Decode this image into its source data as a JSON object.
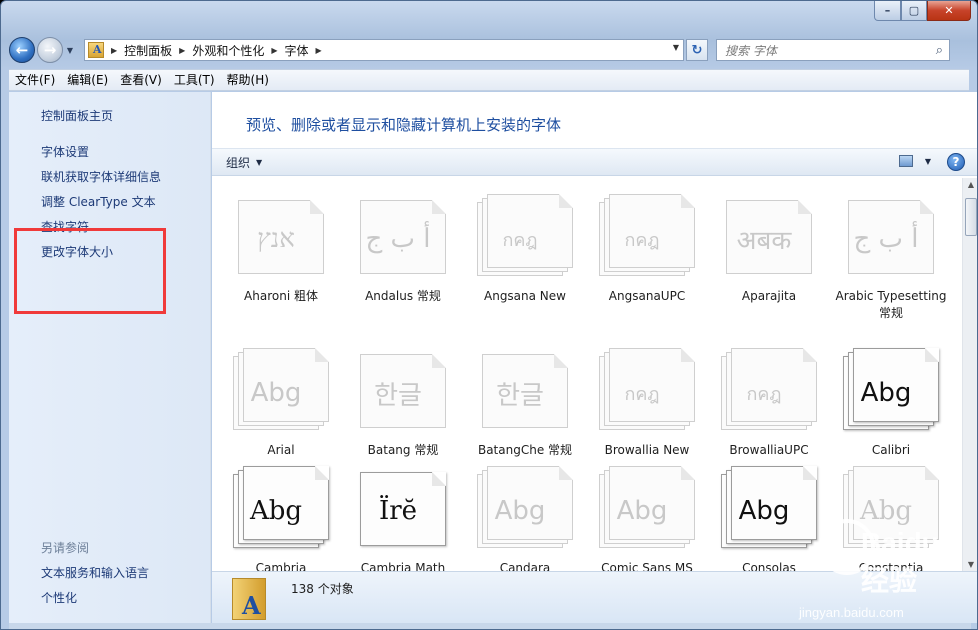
{
  "address": {
    "crumbs": [
      "控制面板",
      "外观和个性化",
      "字体"
    ]
  },
  "search": {
    "placeholder": "搜索 字体"
  },
  "menu": [
    "文件(F)",
    "编辑(E)",
    "查看(V)",
    "工具(T)",
    "帮助(H)"
  ],
  "sidebar": {
    "home": "控制面板主页",
    "links": [
      "字体设置",
      "联机获取字体详细信息",
      "调整 ClearType 文本",
      "查找字符",
      "更改字体大小"
    ],
    "see_also_label": "另请参阅",
    "see_also": [
      "文本服务和输入语言",
      "个性化"
    ]
  },
  "main": {
    "title": "预览、删除或者显示和隐藏计算机上安装的字体",
    "organize_label": "组织",
    "help_glyph": "?"
  },
  "fonts": [
    {
      "name": "Aharoni 粗体",
      "glyph": "אנץ",
      "style": "single-light"
    },
    {
      "name": "Andalus 常规",
      "glyph": "أ ب ج",
      "style": "single-light"
    },
    {
      "name": "Angsana New",
      "glyph": "กคฎ",
      "style": "stack-light"
    },
    {
      "name": "AngsanaUPC",
      "glyph": "กคฎ",
      "style": "stack-light"
    },
    {
      "name": "Aparajita",
      "glyph": "अबक",
      "style": "single-light"
    },
    {
      "name": "Arabic Typesetting 常规",
      "glyph": "أ ب ج",
      "style": "single-light"
    },
    {
      "name": "Arial",
      "glyph": "Abg",
      "style": "stack-light"
    },
    {
      "name": "Batang 常规",
      "glyph": "한글",
      "style": "single-light"
    },
    {
      "name": "BatangChe 常规",
      "glyph": "한글",
      "style": "single-light"
    },
    {
      "name": "Browallia New",
      "glyph": "กคฎ",
      "style": "stack-light"
    },
    {
      "name": "BrowalliaUPC",
      "glyph": "กคฎ",
      "style": "stack-light"
    },
    {
      "name": "Calibri",
      "glyph": "Abg",
      "style": "stack-dark"
    },
    {
      "name": "Cambria",
      "glyph": "Abg",
      "style": "stack-dark-serif"
    },
    {
      "name": "Cambria Math",
      "glyph": "Ïrĕ",
      "style": "single-dark-serif"
    },
    {
      "name": "Candara",
      "glyph": "Abg",
      "style": "stack-light"
    },
    {
      "name": "Comic Sans MS",
      "glyph": "Abg",
      "style": "stack-light"
    },
    {
      "name": "Consolas",
      "glyph": "Abg",
      "style": "stack-dark"
    },
    {
      "name": "Constantia",
      "glyph": "Abg",
      "style": "stack-light-serif"
    }
  ],
  "details": {
    "count": "138 个对象"
  },
  "watermark": {
    "brand": "Baidu 经验",
    "url": "jingyan.baidu.com"
  },
  "colors": {
    "link": "#1d3a77",
    "title": "#1f4fa0",
    "highlight": "#f03a3a"
  }
}
